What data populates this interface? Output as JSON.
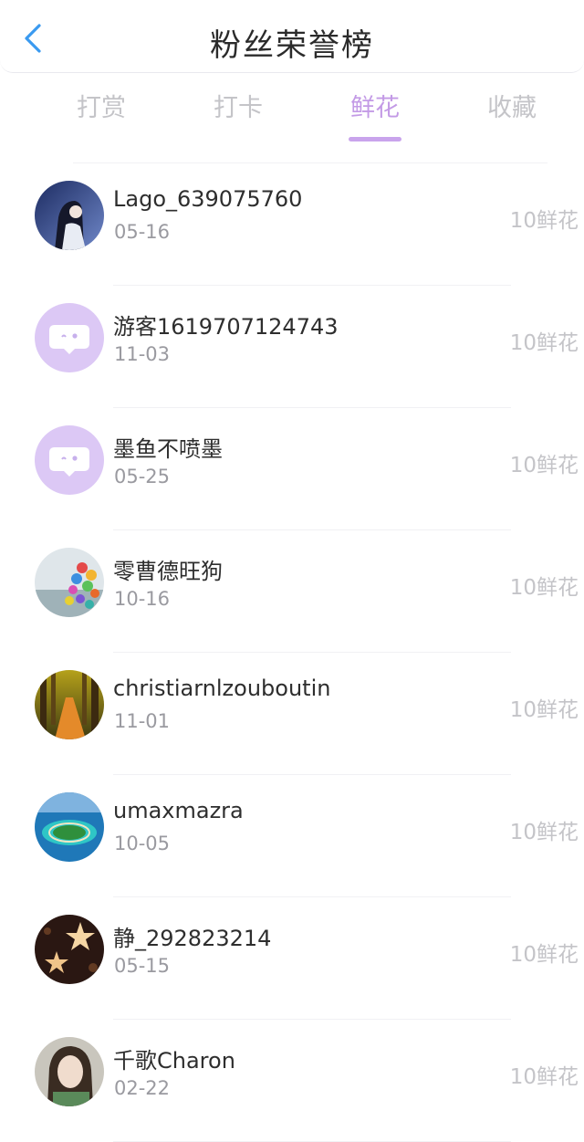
{
  "header": {
    "title": "粉丝荣誉榜"
  },
  "tabs": [
    {
      "label": "打赏",
      "active": false
    },
    {
      "label": "打卡",
      "active": false
    },
    {
      "label": "鲜花",
      "active": true
    },
    {
      "label": "收藏",
      "active": false
    }
  ],
  "colors": {
    "accent": "#c39ae6",
    "back_icon": "#3a9af0",
    "guest_avatar": "#dcc8f5"
  },
  "fans": [
    {
      "name": "Lago_639075760",
      "date": "05-16",
      "amount": "10鲜花",
      "avatar": "photo-girl"
    },
    {
      "name": "游客1619707124743",
      "date": "11-03",
      "amount": "10鲜花",
      "avatar": "guest-chat"
    },
    {
      "name": "墨鱼不喷墨",
      "date": "05-25",
      "amount": "10鲜花",
      "avatar": "guest-chat"
    },
    {
      "name": "零曹德旺狗",
      "date": "10-16",
      "amount": "10鲜花",
      "avatar": "photo-balloons"
    },
    {
      "name": "christiarnlzouboutin",
      "date": "11-01",
      "amount": "10鲜花",
      "avatar": "photo-forest-path"
    },
    {
      "name": "umaxmazra",
      "date": "10-05",
      "amount": "10鲜花",
      "avatar": "photo-island"
    },
    {
      "name": "静_292823214",
      "date": "05-15",
      "amount": "10鲜花",
      "avatar": "photo-stars"
    },
    {
      "name": "千歌Charon",
      "date": "02-22",
      "amount": "10鲜花",
      "avatar": "photo-girl-portrait"
    }
  ]
}
